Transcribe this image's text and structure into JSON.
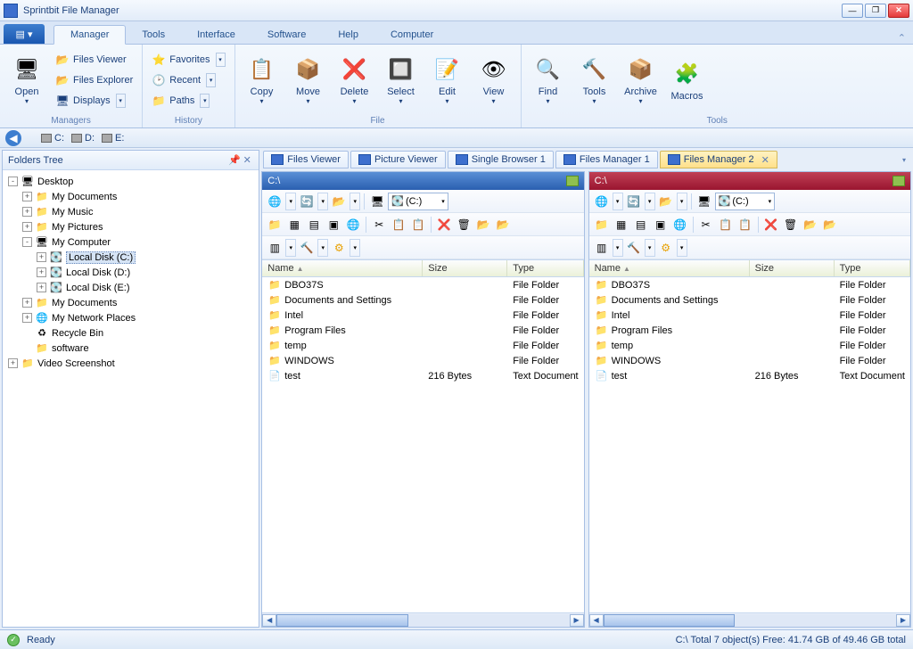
{
  "app": {
    "title": "Sprintbit File Manager"
  },
  "ribbon": {
    "tabs": [
      "Manager",
      "Tools",
      "Interface",
      "Software",
      "Help",
      "Computer"
    ],
    "active": "Manager",
    "groups": {
      "managers": {
        "label": "Managers",
        "open": "Open",
        "files_viewer": "Files Viewer",
        "files_explorer": "Files Explorer",
        "displays": "Displays"
      },
      "history": {
        "label": "History",
        "favorites": "Favorites",
        "recent": "Recent",
        "paths": "Paths"
      },
      "file": {
        "label": "File",
        "copy": "Copy",
        "move": "Move",
        "delete": "Delete",
        "select": "Select",
        "edit": "Edit",
        "view": "View"
      },
      "tools": {
        "label": "Tools",
        "find": "Find",
        "tools": "Tools",
        "archive": "Archive",
        "macros": "Macros"
      }
    }
  },
  "drivebar": {
    "drives": [
      "C:",
      "D:",
      "E:"
    ]
  },
  "tree": {
    "title": "Folders Tree",
    "nodes": [
      {
        "depth": 0,
        "exp": "-",
        "icon": "monitor",
        "label": "Desktop"
      },
      {
        "depth": 1,
        "exp": "+",
        "icon": "folder",
        "label": "My Documents"
      },
      {
        "depth": 1,
        "exp": "+",
        "icon": "folder",
        "label": "My Music"
      },
      {
        "depth": 1,
        "exp": "+",
        "icon": "folder",
        "label": "My Pictures"
      },
      {
        "depth": 1,
        "exp": "-",
        "icon": "monitor",
        "label": "My Computer"
      },
      {
        "depth": 2,
        "exp": "+",
        "icon": "disk",
        "label": "Local Disk (C:)",
        "selected": true
      },
      {
        "depth": 2,
        "exp": "+",
        "icon": "disk",
        "label": "Local Disk (D:)"
      },
      {
        "depth": 2,
        "exp": "+",
        "icon": "disk",
        "label": "Local Disk (E:)"
      },
      {
        "depth": 1,
        "exp": "+",
        "icon": "folder",
        "label": "My Documents"
      },
      {
        "depth": 1,
        "exp": "+",
        "icon": "net",
        "label": "My Network Places"
      },
      {
        "depth": 1,
        "exp": " ",
        "icon": "bin",
        "label": "Recycle Bin"
      },
      {
        "depth": 1,
        "exp": " ",
        "icon": "folder",
        "label": "software"
      },
      {
        "depth": 0,
        "exp": "+",
        "icon": "folder",
        "label": "Video Screenshot"
      }
    ]
  },
  "viewtabs": {
    "tabs": [
      {
        "label": "Files Viewer"
      },
      {
        "label": "Picture Viewer"
      },
      {
        "label": "Single Browser 1"
      },
      {
        "label": "Files Manager 1"
      },
      {
        "label": "Files Manager 2",
        "active": true,
        "closable": true
      }
    ]
  },
  "panes": {
    "left": {
      "path": "C:\\",
      "drive": "(C:)"
    },
    "right": {
      "path": "C:\\",
      "drive": "(C:)"
    }
  },
  "columns": {
    "name": "Name",
    "size": "Size",
    "type": "Type"
  },
  "files": [
    {
      "icon": "folder",
      "name": "DBO37S",
      "size": "",
      "type": "File Folder"
    },
    {
      "icon": "folder",
      "name": "Documents and Settings",
      "size": "",
      "type": "File Folder"
    },
    {
      "icon": "folder",
      "name": "Intel",
      "size": "",
      "type": "File Folder"
    },
    {
      "icon": "folder",
      "name": "Program Files",
      "size": "",
      "type": "File Folder"
    },
    {
      "icon": "folder",
      "name": "temp",
      "size": "",
      "type": "File Folder"
    },
    {
      "icon": "folder",
      "name": "WINDOWS",
      "size": "",
      "type": "File Folder"
    },
    {
      "icon": "doc",
      "name": "test",
      "size": "216 Bytes",
      "type": "Text Document"
    }
  ],
  "status": {
    "ready": "Ready",
    "summary": "C:\\ Total 7 object(s) Free: 41.74 GB of 49.46 GB total"
  }
}
